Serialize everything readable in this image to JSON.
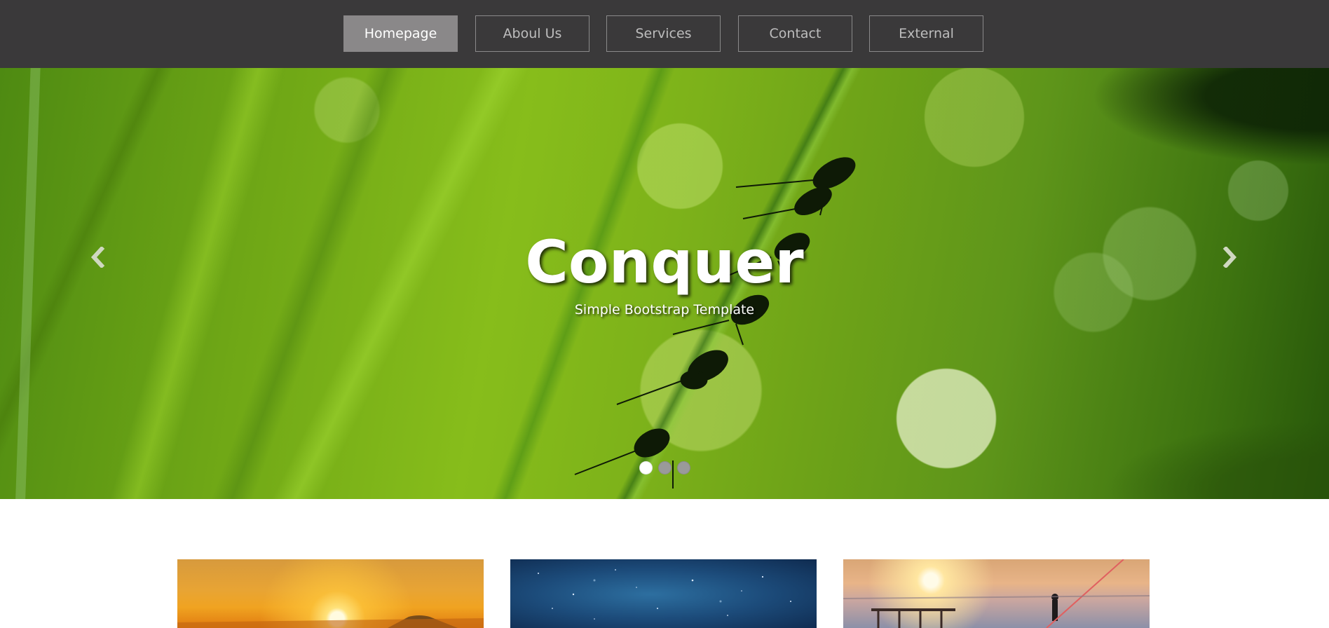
{
  "nav": {
    "items": [
      {
        "label": "Homepage",
        "active": true
      },
      {
        "label": "Aboul Us",
        "active": false
      },
      {
        "label": "Services",
        "active": false
      },
      {
        "label": "Contact",
        "active": false
      },
      {
        "label": "External",
        "active": false
      }
    ]
  },
  "hero": {
    "title": "Conquer",
    "subtitle": "Simple Bootstrap Template",
    "prev_icon": "chevron-left-icon",
    "next_icon": "chevron-right-icon",
    "slides_count": 3,
    "active_slide": 1
  },
  "thumbnails": [
    {
      "name": "sunrise-image"
    },
    {
      "name": "starry-sky-image"
    },
    {
      "name": "sunset-pier-image"
    }
  ],
  "colors": {
    "navbar_bg": "#3a393a",
    "nav_active_bg": "#8a8889",
    "nav_border": "#8a8a8a",
    "nav_text": "#bdbdbd"
  }
}
